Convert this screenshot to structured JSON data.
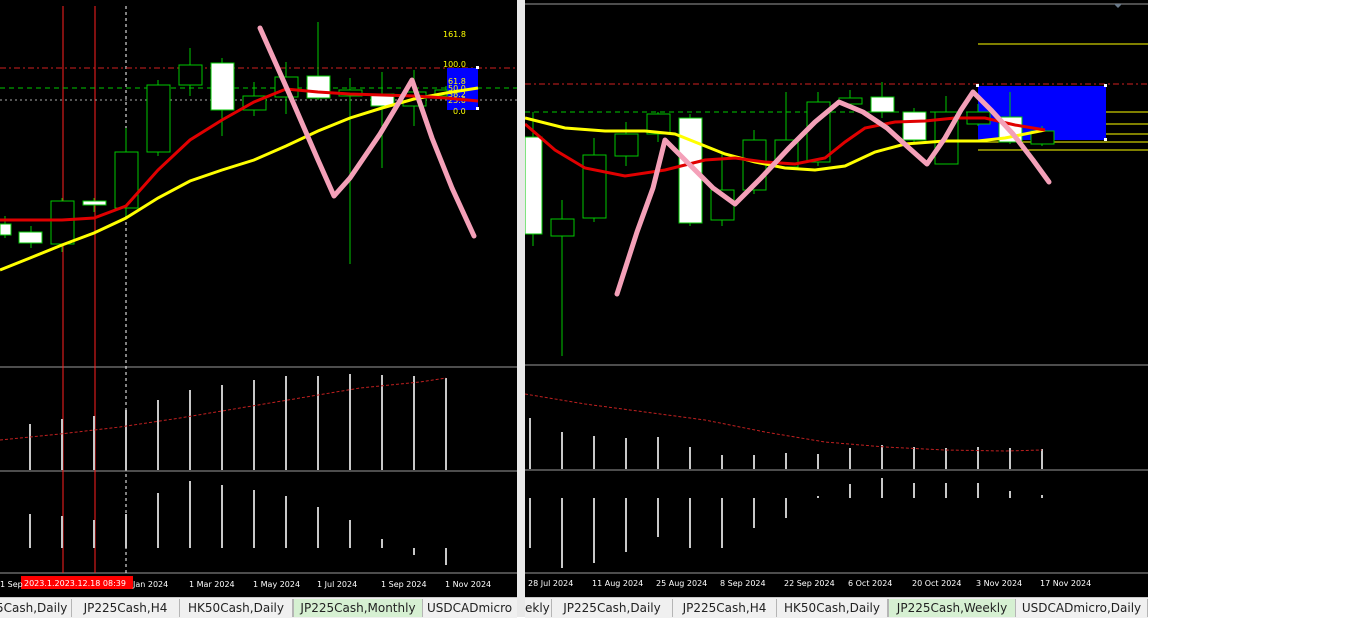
{
  "left_chart": {
    "fib_levels": [
      "161.8",
      "100.0",
      "61.8",
      "50.0",
      "38.2",
      "23.6",
      "0.0"
    ],
    "time_labels": [
      "1 Sep",
      "Jan 2024",
      "1 Mar 2024",
      "1 May 2024",
      "1 Jul 2024",
      "1 Sep 2024",
      "1 Nov 2024"
    ],
    "highlighted_time": "2023.1.2023.12.18 08:39"
  },
  "right_chart": {
    "time_labels": [
      "28 Jul 2024",
      "11 Aug 2024",
      "25 Aug 2024",
      "8 Sep 2024",
      "22 Sep 2024",
      "6 Oct 2024",
      "20 Oct 2024",
      "3 Nov 2024",
      "17 Nov 2024"
    ]
  },
  "left_tabs": [
    {
      "label": "5Cash,Daily",
      "active": false
    },
    {
      "label": "JP225Cash,H4",
      "active": false
    },
    {
      "label": "HK50Cash,Daily",
      "active": false
    },
    {
      "label": "JP225Cash,Monthly",
      "active": true
    },
    {
      "label": "USDCADmicro",
      "active": false
    }
  ],
  "right_tabs": [
    {
      "label": "ekly",
      "active": false
    },
    {
      "label": "JP225Cash,Daily",
      "active": false
    },
    {
      "label": "JP225Cash,H4",
      "active": false
    },
    {
      "label": "HK50Cash,Daily",
      "active": false
    },
    {
      "label": "JP225Cash,Weekly",
      "active": true
    },
    {
      "label": "USDCADmicro,Daily",
      "active": false
    }
  ],
  "colors": {
    "background": "#000000",
    "bull_candle": "#00c800",
    "bear_candle_fill": "#ffffff",
    "ma_fast": "#e00000",
    "ma_slow": "#ffff00",
    "fib_zone": "#0000ff",
    "fib_text": "#ffff00",
    "annotation": "#f4a0b8",
    "histogram": "#c8c8c8"
  }
}
